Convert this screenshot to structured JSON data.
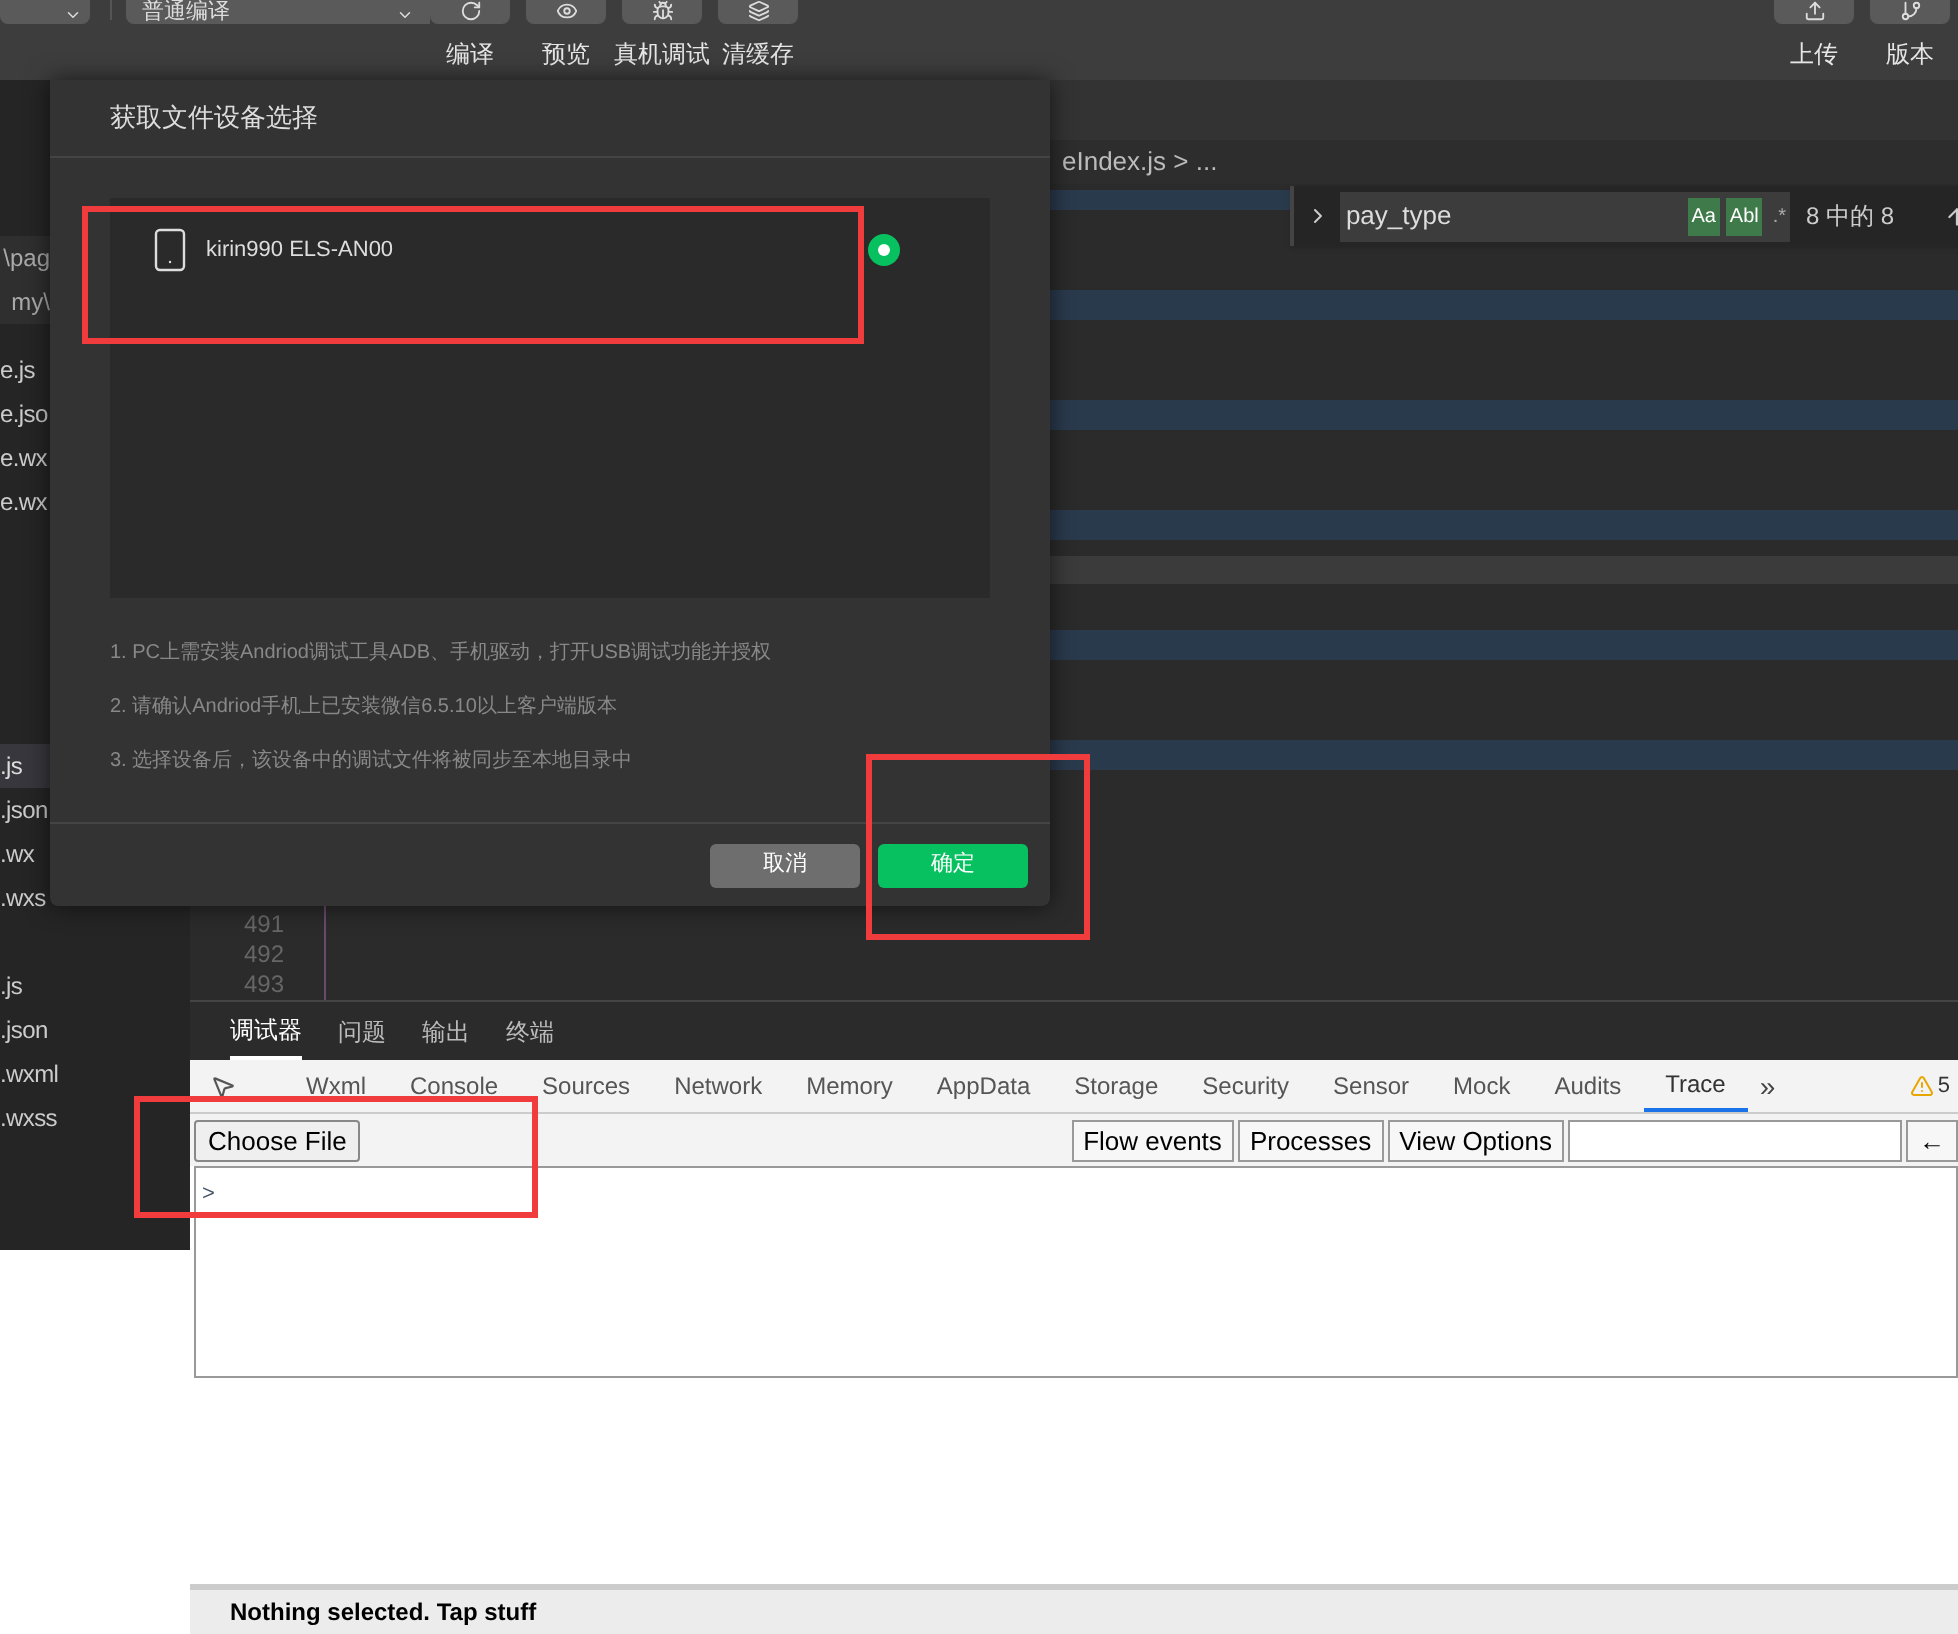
{
  "toolbar": {
    "mode_select": "普通编译",
    "actions": [
      {
        "label": "编译",
        "kind": "refresh"
      },
      {
        "label": "预览",
        "kind": "eye"
      },
      {
        "label": "真机调试",
        "kind": "bug"
      },
      {
        "label": "清缓存",
        "kind": "layers"
      }
    ],
    "right_actions": [
      {
        "label": "上传",
        "kind": "upload"
      },
      {
        "label": "版本",
        "kind": "branch"
      }
    ]
  },
  "sidebar": {
    "path_items": [
      "\\pag",
      "my\\"
    ],
    "files": [
      {
        "name": "e.js",
        "selected": false
      },
      {
        "name": "e.jso",
        "selected": false
      },
      {
        "name": "e.wx",
        "selected": false
      },
      {
        "name": "e.wx",
        "selected": false
      },
      {
        "name": ".js",
        "selected": true
      },
      {
        "name": ".json",
        "selected": false
      },
      {
        "name": ".wx",
        "selected": false
      },
      {
        "name": ".wxs",
        "selected": false
      },
      {
        "name": ".js",
        "selected": false
      },
      {
        "name": ".json",
        "selected": false
      },
      {
        "name": ".wxml",
        "selected": false
      },
      {
        "name": ".wxss",
        "selected": false
      }
    ]
  },
  "editor": {
    "breadcrumb": "eIndex.js > ...",
    "line_numbers": [
      "491",
      "492",
      "493"
    ],
    "find": {
      "query": "pay_type",
      "toggles": [
        {
          "label": "Aa",
          "on": true
        },
        {
          "label": "Abl",
          "on": true
        },
        {
          "label": ".*",
          "on": false
        }
      ],
      "count": "8 中的 8"
    }
  },
  "dialog": {
    "title": "获取文件设备选择",
    "devices": [
      {
        "name": "kirin990 ELS-AN00",
        "selected": true
      }
    ],
    "notes": [
      "1. PC上需安装Andriod调试工具ADB、手机驱动，打开USB调试功能并授权",
      "2. 请确认Andriod手机上已安装微信6.5.10以上客户端版本",
      "3. 选择设备后，该设备中的调试文件将被同步至本地目录中"
    ],
    "buttons": [
      {
        "label": "取消",
        "kind": "secondary"
      },
      {
        "label": "确定",
        "kind": "primary"
      }
    ]
  },
  "panel_tabs": [
    {
      "label": "调试器",
      "selected": true
    },
    {
      "label": "问题",
      "selected": false
    },
    {
      "label": "输出",
      "selected": false
    },
    {
      "label": "终端",
      "selected": false
    }
  ],
  "devtools": {
    "tabs": [
      {
        "label": "Wxml",
        "selected": false
      },
      {
        "label": "Console",
        "selected": false
      },
      {
        "label": "Sources",
        "selected": false
      },
      {
        "label": "Network",
        "selected": false
      },
      {
        "label": "Memory",
        "selected": false
      },
      {
        "label": "AppData",
        "selected": false
      },
      {
        "label": "Storage",
        "selected": false
      },
      {
        "label": "Security",
        "selected": false
      },
      {
        "label": "Sensor",
        "selected": false
      },
      {
        "label": "Mock",
        "selected": false
      },
      {
        "label": "Audits",
        "selected": false
      },
      {
        "label": "Trace",
        "selected": true
      }
    ],
    "more": "»",
    "warnings": "5",
    "choose_file": "Choose File",
    "buttons": [
      "Flow events",
      "Processes",
      "View Options"
    ],
    "back": "←",
    "prompt": ">",
    "status": "Nothing selected. Tap stuff"
  }
}
